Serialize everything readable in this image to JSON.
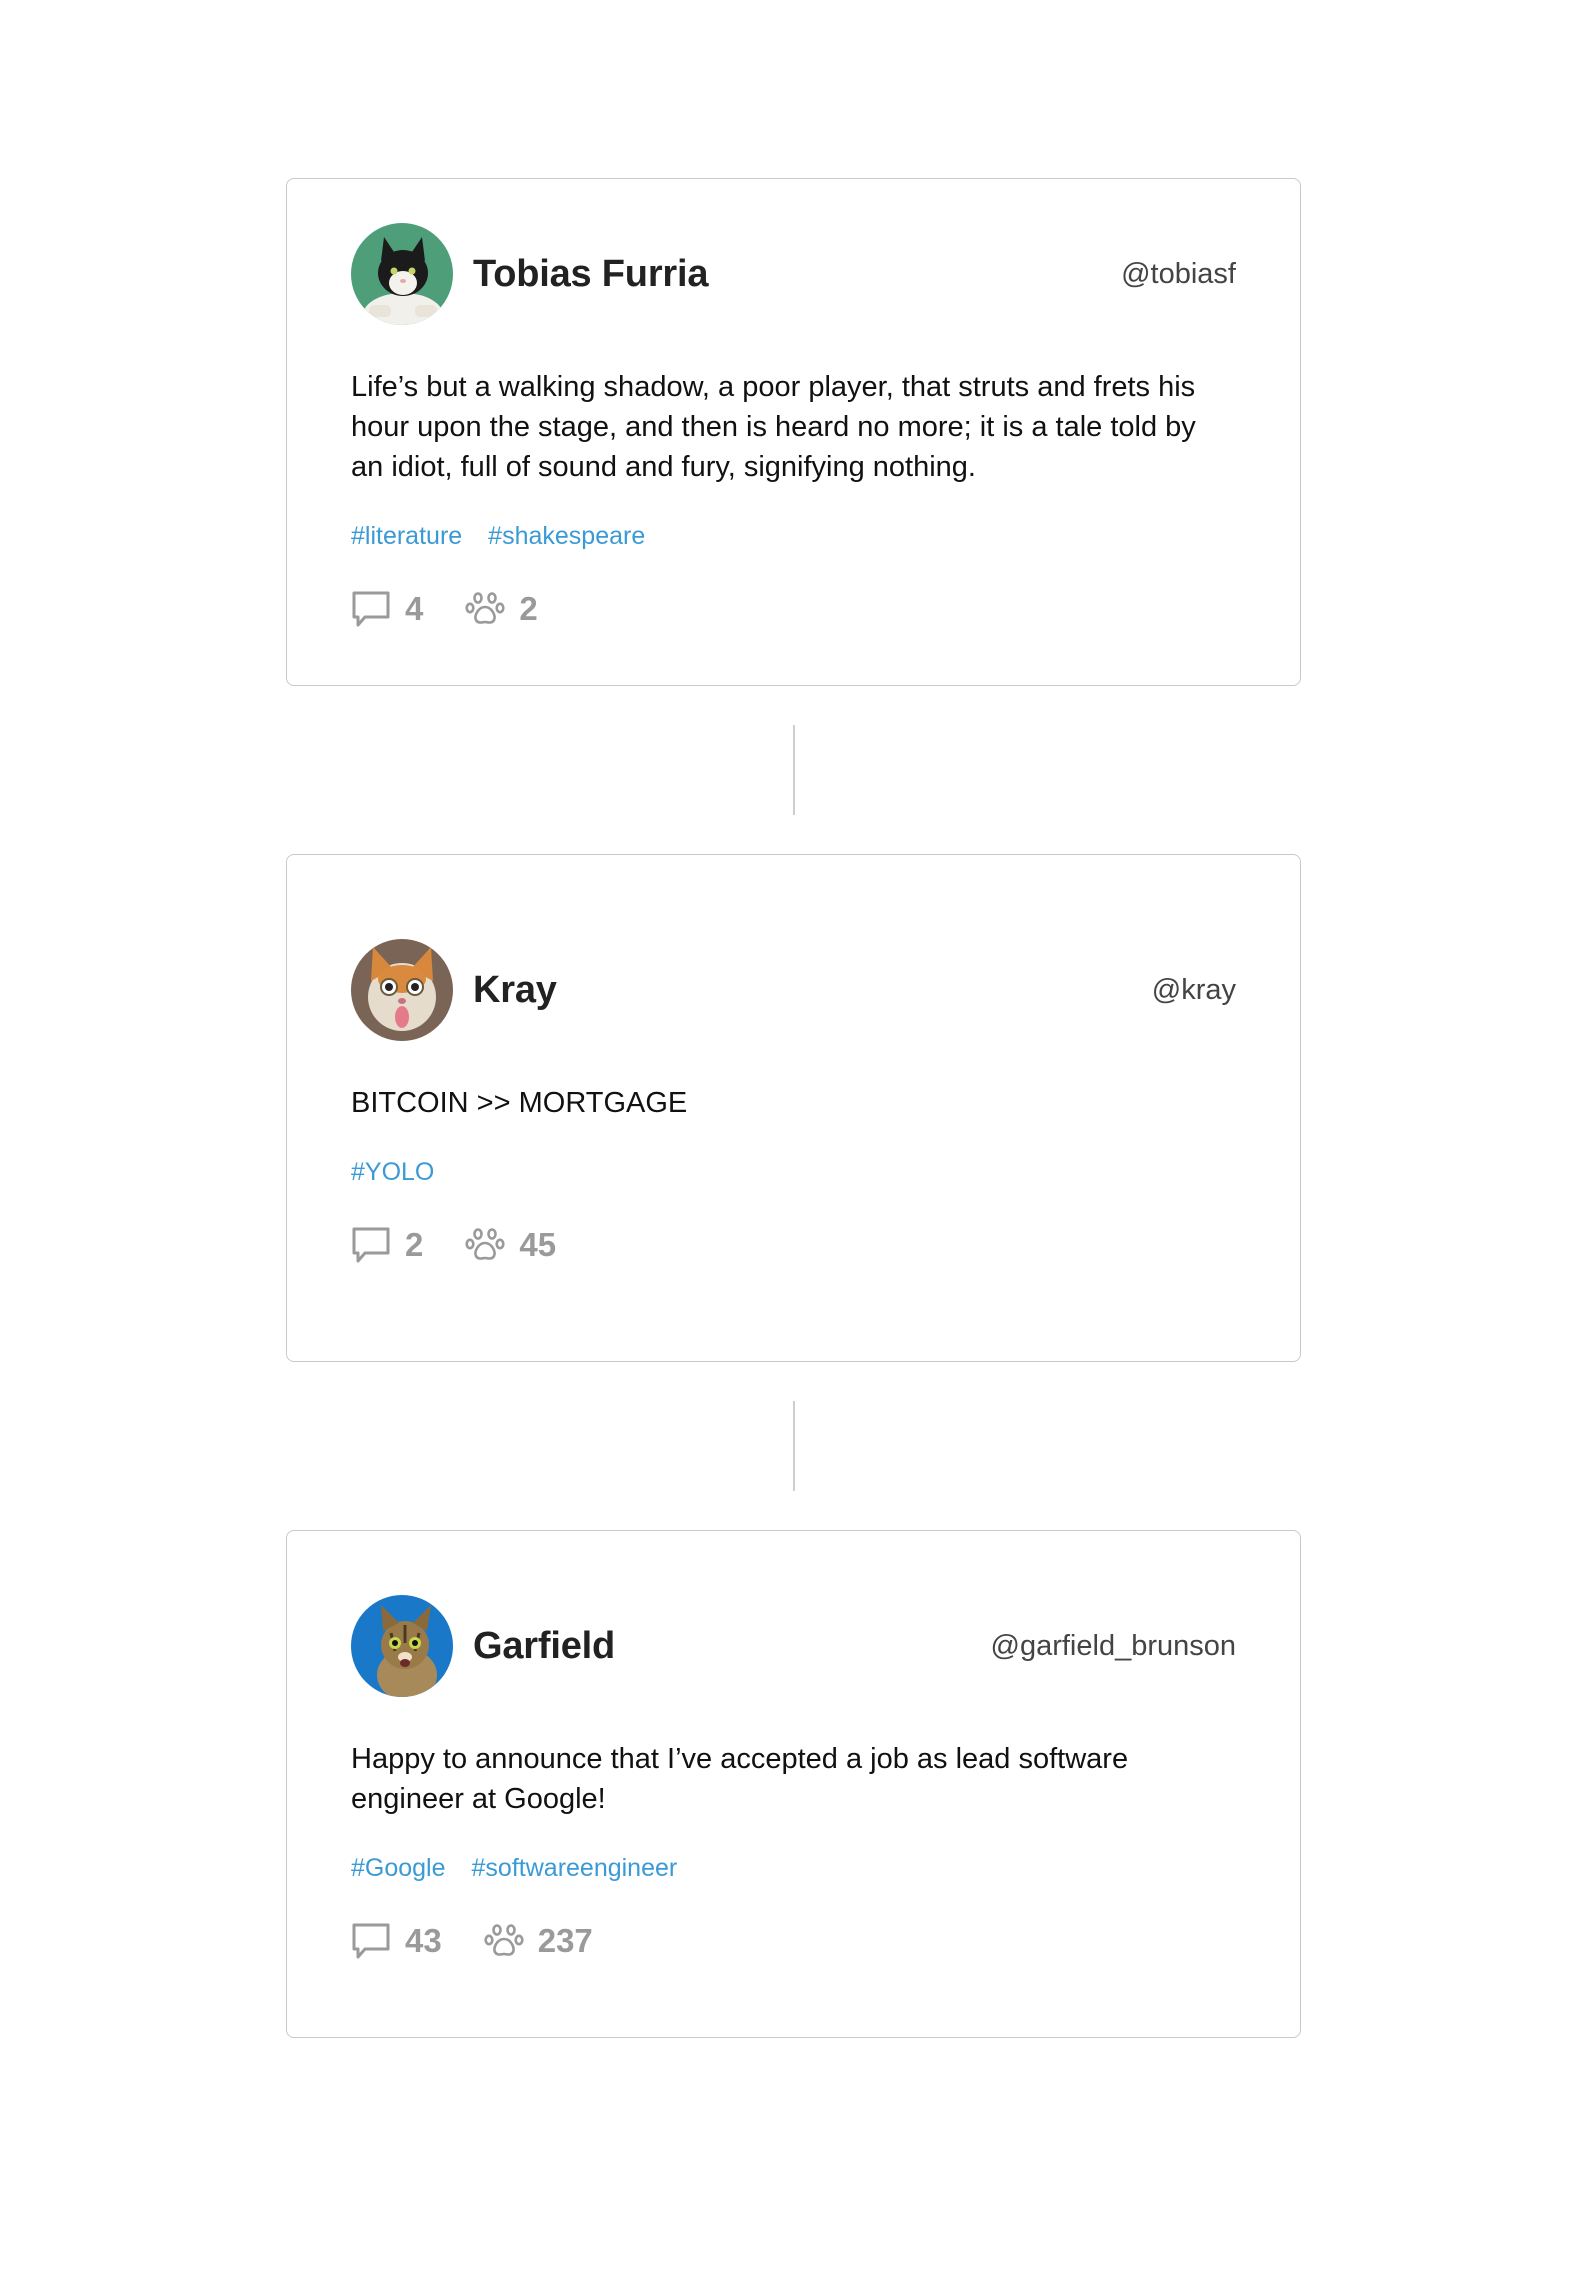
{
  "posts": [
    {
      "author_name": "Tobias Furria",
      "handle": "@tobiasf",
      "text": "Life’s but a walking shadow, a poor player, that struts and frets his hour upon the stage, and then is heard no more; it is a tale told by an idiot, full of sound and fury, signifying nothing.",
      "tags": [
        "#literature",
        "#shakespeare"
      ],
      "comments": "4",
      "paws": "2",
      "avatar_bg": "#4e9e7a"
    },
    {
      "author_name": "Kray",
      "handle": "@kray",
      "text": "BITCOIN >> MORTGAGE",
      "tags": [
        "#YOLO"
      ],
      "comments": "2",
      "paws": "45",
      "avatar_bg": "#8a6a58"
    },
    {
      "author_name": "Garfield",
      "handle": "@garfield_brunson",
      "text": "Happy to announce that I’ve accepted a job as lead software engineer at Google!",
      "tags": [
        "#Google",
        "#softwareengineer"
      ],
      "comments": "43",
      "paws": "237",
      "avatar_bg": "#1a78c8"
    }
  ],
  "icons": {
    "comment": "comment-icon",
    "paw": "paw-icon"
  },
  "colors": {
    "tag": "#3a9ad6",
    "stat": "#9a9a9a",
    "border": "#c9c9c9"
  }
}
